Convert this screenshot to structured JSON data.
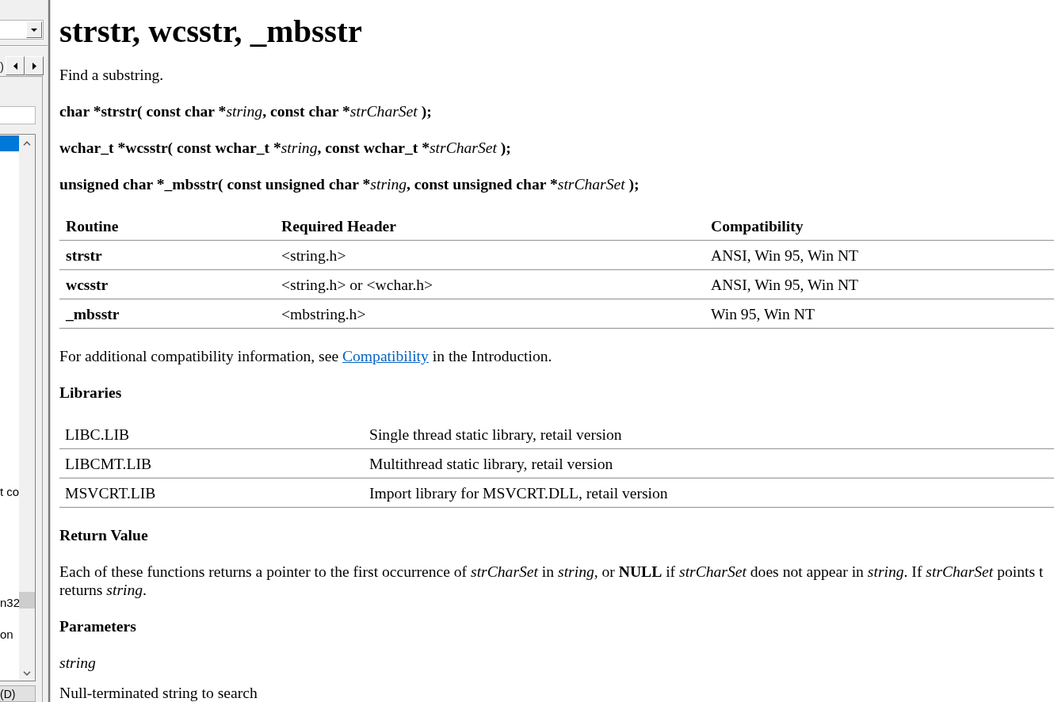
{
  "sidebar": {
    "tab_label": ")",
    "list": {
      "items": [
        {
          "selected": true
        },
        {
          "label": "t co",
          "selected": false
        },
        {
          "label": "n32",
          "selected": false
        },
        {
          "label": "on",
          "selected": false
        }
      ]
    },
    "button": "(D)"
  },
  "page": {
    "title": "strstr, wcsstr, _mbsstr",
    "summary": "Find a substring.",
    "syntax": [
      {
        "parts": [
          {
            "text": "char *strstr( const char *",
            "italic": false
          },
          {
            "text": "string",
            "italic": true
          },
          {
            "text": ", const char *",
            "italic": false
          },
          {
            "text": "strCharSet",
            "italic": true
          },
          {
            "text": " );",
            "italic": false
          }
        ]
      },
      {
        "parts": [
          {
            "text": "wchar_t *wcsstr( const wchar_t *",
            "italic": false
          },
          {
            "text": "string",
            "italic": true
          },
          {
            "text": ", const wchar_t *",
            "italic": false
          },
          {
            "text": "strCharSet",
            "italic": true
          },
          {
            "text": " );",
            "italic": false
          }
        ]
      },
      {
        "parts": [
          {
            "text": "unsigned char *_mbsstr( const unsigned char *",
            "italic": false
          },
          {
            "text": "string",
            "italic": true
          },
          {
            "text": ", const unsigned char *",
            "italic": false
          },
          {
            "text": "strCharSet",
            "italic": true
          },
          {
            "text": " );",
            "italic": false
          }
        ]
      }
    ],
    "routines_table": {
      "columns": [
        "Routine",
        "Required Header",
        "Compatibility"
      ],
      "rows": [
        [
          "strstr",
          "<string.h>",
          "ANSI, Win 95, Win NT"
        ],
        [
          "wcsstr",
          "<string.h> or <wchar.h>",
          "ANSI, Win 95, Win NT"
        ],
        [
          "_mbsstr",
          "<mbstring.h>",
          "Win 95, Win NT"
        ]
      ]
    },
    "compatibility_note": {
      "before": "For additional compatibility information, see",
      "link": "Compatibility",
      "after": "in the Introduction."
    },
    "libraries": {
      "heading": "Libraries",
      "rows": [
        [
          "LIBC.LIB",
          "Single thread static library, retail version"
        ],
        [
          "LIBCMT.LIB",
          "Multithread static library, retail version"
        ],
        [
          "MSVCRT.LIB",
          "Import library for MSVCRT.DLL, retail version"
        ]
      ]
    },
    "return_value": {
      "heading": "Return Value",
      "lines": [
        "Each of these functions returns a pointer to the first occurrence of *strCharSet* in *string*, or **NULL** if *strCharSet* does not appear in *string*. If *strCharSet* points t",
        "returns *string*."
      ]
    },
    "parameters": {
      "heading": "Parameters",
      "items": [
        {
          "name": "string",
          "description": "Null-terminated string to search"
        }
      ]
    }
  }
}
